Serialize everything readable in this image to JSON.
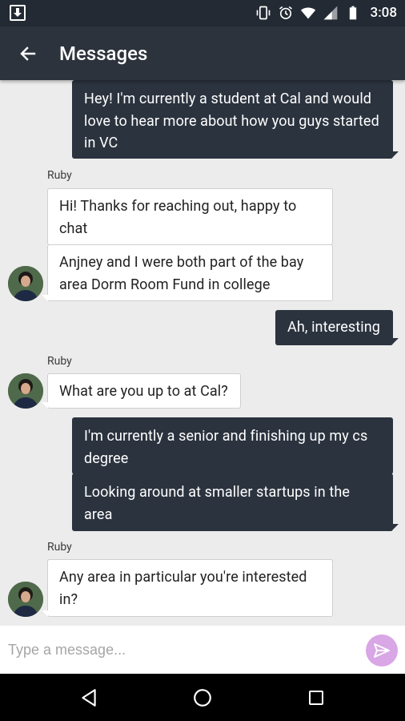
{
  "status_bar": {
    "time": "3:08"
  },
  "app_bar": {
    "title": "Messages"
  },
  "messages": [
    {
      "direction": "outgoing",
      "text": "Hey! I'm currently a student at Cal and would love to hear more about how you guys started in VC"
    },
    {
      "direction": "incoming",
      "sender": "Ruby",
      "texts": [
        "Hi! Thanks for reaching out, happy to chat",
        "Anjney and I were both part of the bay area Dorm Room Fund in college"
      ]
    },
    {
      "direction": "outgoing",
      "text": "Ah, interesting"
    },
    {
      "direction": "incoming",
      "sender": "Ruby",
      "texts": [
        "What are you up to at Cal?"
      ]
    },
    {
      "direction": "outgoing",
      "texts": [
        "I'm currently a senior and finishing up my cs degree",
        "Looking around at smaller startups in the area"
      ]
    },
    {
      "direction": "incoming",
      "sender": "Ruby",
      "texts": [
        "Any area in particular you're interested in?"
      ]
    }
  ],
  "composer": {
    "placeholder": "Type a message..."
  },
  "colors": {
    "app_bar": "#2c333d",
    "status_bar": "#232a33",
    "outgoing_bubble": "#2b333e",
    "incoming_bubble": "#ffffff",
    "background": "#ececec",
    "send_button": "#d9a6e6"
  },
  "icons": {
    "back": "arrow-left-icon",
    "send": "send-icon",
    "nav_back": "triangle-back-icon",
    "nav_home": "circle-home-icon",
    "nav_recents": "square-recents-icon"
  }
}
